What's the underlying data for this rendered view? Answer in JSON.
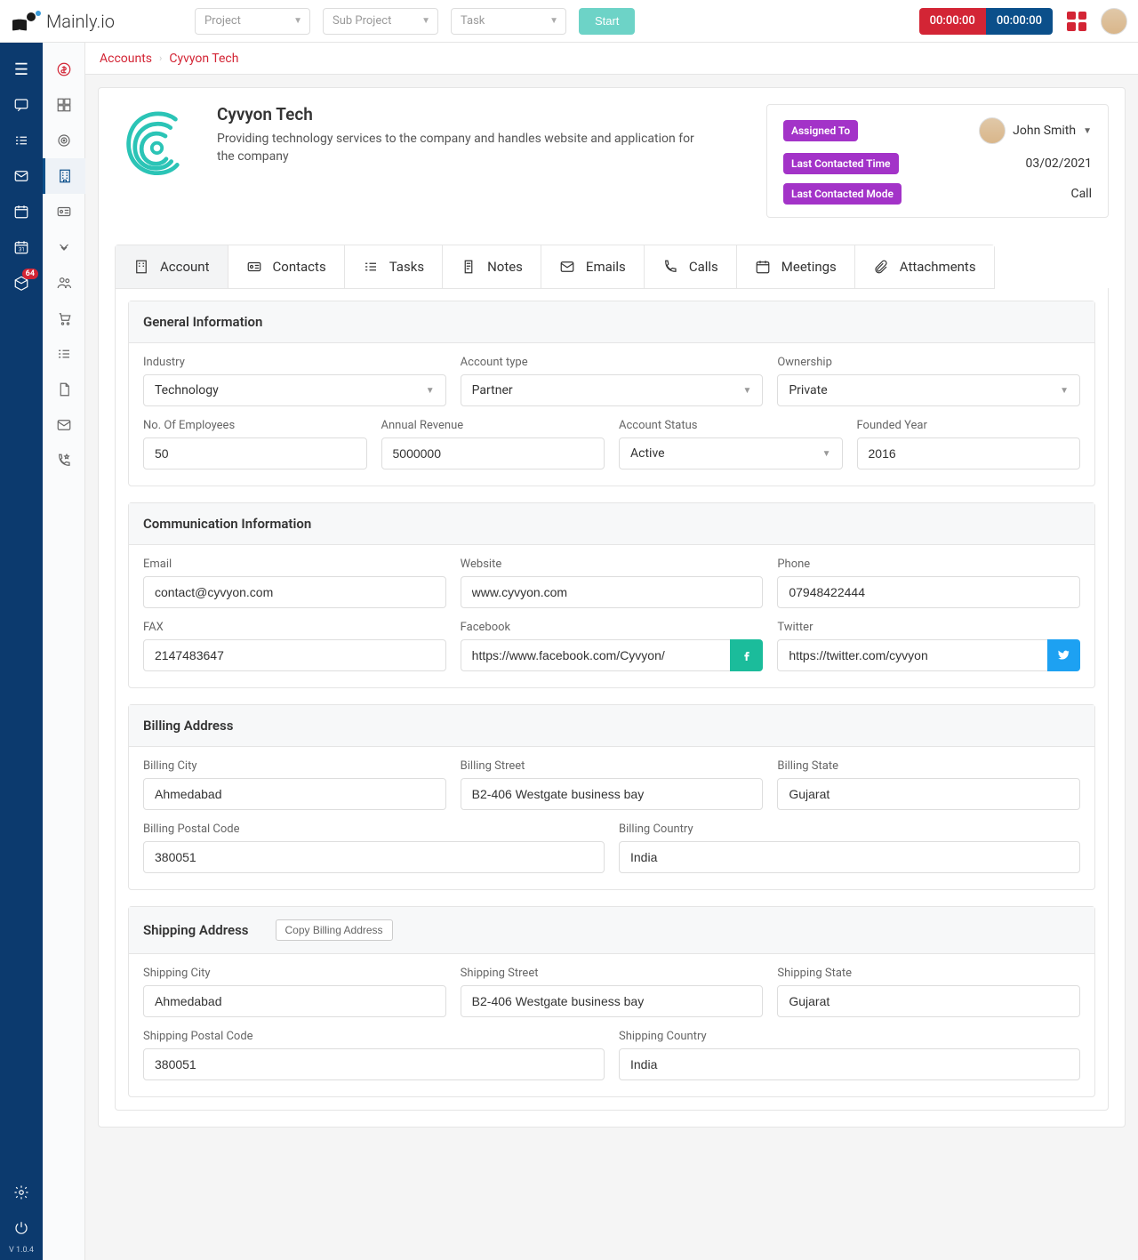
{
  "brand": "Mainly.io",
  "topbar": {
    "selects": [
      {
        "name": "project-select",
        "label": "Project"
      },
      {
        "name": "subproject-select",
        "label": "Sub Project"
      },
      {
        "name": "task-select",
        "label": "Task"
      }
    ],
    "start_label": "Start",
    "timer1": "00:00:00",
    "timer2": "00:00:00"
  },
  "leftrail": {
    "top_items": [
      "hamburger-icon",
      "chat-icon",
      "checklist-icon",
      "mail-icon",
      "calendar-icon",
      "calendar-alt-icon",
      "box-open-icon"
    ],
    "box_badge": "64",
    "bottom_items": [
      "gear-icon",
      "power-icon"
    ],
    "version": "V 1.0.4"
  },
  "secondrail": {
    "items": [
      "dollar-icon",
      "grid-icon",
      "target-icon",
      "building-icon",
      "card-icon",
      "handshake-icon",
      "group-icon",
      "cart-icon",
      "list-icon",
      "file-icon",
      "mail-outline-icon",
      "call-star-icon"
    ],
    "active_index": 3
  },
  "breadcrumb": {
    "root": "Accounts",
    "current": "Cyvyon Tech"
  },
  "account": {
    "name": "Cyvyon Tech",
    "description": "Providing technology services to the company and handles website and application for the company"
  },
  "assign_card": {
    "assigned_to_tag": "Assigned To",
    "assigned_to_name": "John Smith",
    "last_contacted_time_tag": "Last Contacted Time",
    "last_contacted_time_value": "03/02/2021",
    "last_contacted_mode_tag": "Last Contacted Mode",
    "last_contacted_mode_value": "Call"
  },
  "tabs": [
    {
      "name": "tab-account",
      "label": "Account",
      "icon": "building-icon"
    },
    {
      "name": "tab-contacts",
      "label": "Contacts",
      "icon": "id-card-icon"
    },
    {
      "name": "tab-tasks",
      "label": "Tasks",
      "icon": "tasks-icon"
    },
    {
      "name": "tab-notes",
      "label": "Notes",
      "icon": "notes-icon"
    },
    {
      "name": "tab-emails",
      "label": "Emails",
      "icon": "mail-icon"
    },
    {
      "name": "tab-calls",
      "label": "Calls",
      "icon": "phone-icon"
    },
    {
      "name": "tab-meetings",
      "label": "Meetings",
      "icon": "calendar-icon"
    },
    {
      "name": "tab-attachments",
      "label": "Attachments",
      "icon": "paperclip-icon"
    }
  ],
  "active_tab": 0,
  "sections": {
    "general": {
      "title": "General Information",
      "industry_label": "Industry",
      "industry_value": "Technology",
      "account_type_label": "Account type",
      "account_type_value": "Partner",
      "ownership_label": "Ownership",
      "ownership_value": "Private",
      "no_employees_label": "No. Of Employees",
      "no_employees_value": "50",
      "annual_revenue_label": "Annual Revenue",
      "annual_revenue_value": "5000000",
      "account_status_label": "Account Status",
      "account_status_value": "Active",
      "founded_year_label": "Founded Year",
      "founded_year_value": "2016"
    },
    "communication": {
      "title": "Communication Information",
      "email_label": "Email",
      "email_value": "contact@cyvyon.com",
      "website_label": "Website",
      "website_value": "www.cyvyon.com",
      "phone_label": "Phone",
      "phone_value": "07948422444",
      "fax_label": "FAX",
      "fax_value": "2147483647",
      "facebook_label": "Facebook",
      "facebook_value": "https://www.facebook.com/Cyvyon/",
      "twitter_label": "Twitter",
      "twitter_value": "https://twitter.com/cyvyon"
    },
    "billing": {
      "title": "Billing Address",
      "city_label": "Billing City",
      "city_value": "Ahmedabad",
      "street_label": "Billing Street",
      "street_value": "B2-406 Westgate business bay",
      "state_label": "Billing State",
      "state_value": "Gujarat",
      "postal_label": "Billing Postal Code",
      "postal_value": "380051",
      "country_label": "Billing Country",
      "country_value": "India"
    },
    "shipping": {
      "title": "Shipping Address",
      "copy_label": "Copy Billing Address",
      "city_label": "Shipping City",
      "city_value": "Ahmedabad",
      "street_label": "Shipping Street",
      "street_value": "B2-406 Westgate business bay",
      "state_label": "Shipping State",
      "state_value": "Gujarat",
      "postal_label": "Shipping Postal Code",
      "postal_value": "380051",
      "country_label": "Shipping Country",
      "country_value": "India"
    }
  }
}
